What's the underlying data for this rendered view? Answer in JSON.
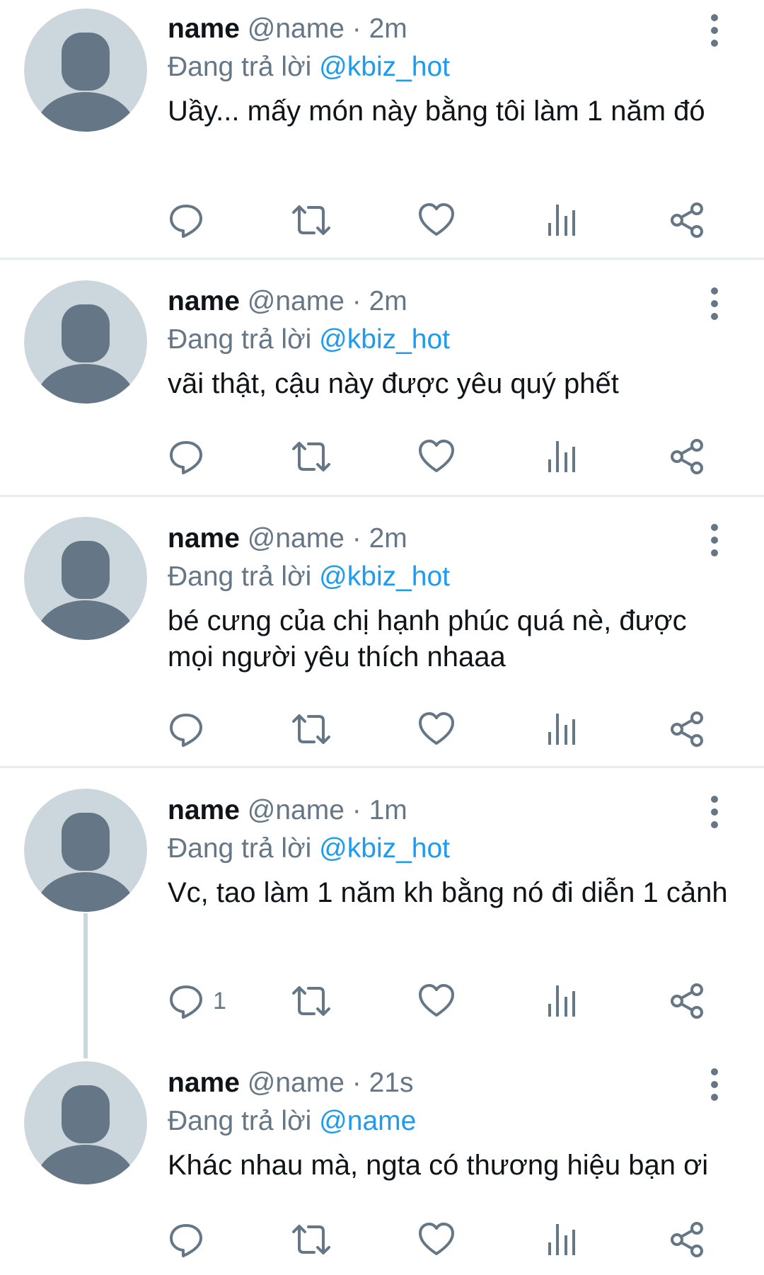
{
  "tweets": [
    {
      "name": "name",
      "handle": "@name",
      "separator": "·",
      "time": "2m",
      "reply_prefix": "Đang trả lời",
      "reply_to": "@kbiz_hot",
      "text": "Uầy... mấy món này bằng tôi làm 1 năm đó",
      "reply_count": ""
    },
    {
      "name": "name",
      "handle": "@name",
      "separator": "·",
      "time": "2m",
      "reply_prefix": "Đang trả lời",
      "reply_to": "@kbiz_hot",
      "text": "vãi thật, cậu này được yêu quý phết",
      "reply_count": ""
    },
    {
      "name": "name",
      "handle": "@name",
      "separator": "·",
      "time": "2m",
      "reply_prefix": "Đang trả lời",
      "reply_to": "@kbiz_hot",
      "text": "bé cưng của chị hạnh phúc quá nè, được mọi người yêu thích nhaaa",
      "reply_count": ""
    },
    {
      "name": "name",
      "handle": "@name",
      "separator": "·",
      "time": "1m",
      "reply_prefix": "Đang trả lời",
      "reply_to": "@kbiz_hot",
      "text": "Vc, tao làm 1 năm kh bằng nó đi diễn 1 cảnh",
      "reply_count": "1"
    },
    {
      "name": "name",
      "handle": "@name",
      "separator": "·",
      "time": "21s",
      "reply_prefix": "Đang trả lời",
      "reply_to": "@name",
      "text": "Khác nhau mà, ngta có thương hiệu bạn ơi",
      "reply_count": ""
    }
  ],
  "icons": {
    "avatar": "default-avatar-icon",
    "more": "more-vertical-icon",
    "reply": "reply-icon",
    "retweet": "retweet-icon",
    "like": "heart-icon",
    "stats": "stats-icon",
    "share": "share-icon"
  },
  "colors": {
    "accent": "#1d9bf0",
    "secondary_text": "#657786",
    "icon": "#657786",
    "avatar_bg": "#ccd6dd",
    "avatar_fg": "#657786",
    "divider": "#e6ecf0"
  }
}
